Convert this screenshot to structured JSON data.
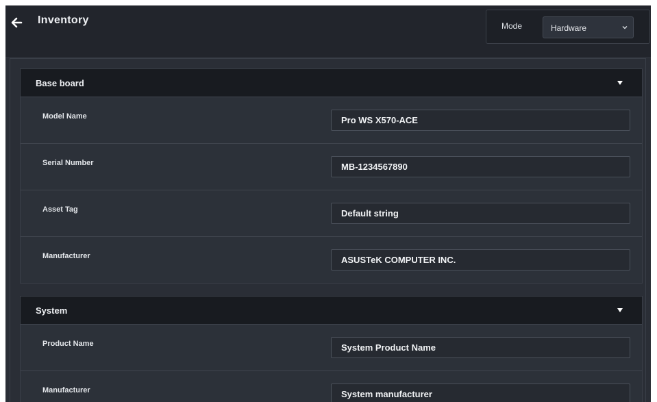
{
  "header": {
    "title": "Inventory",
    "back_icon": "arrow-left-icon",
    "mode_label": "Mode",
    "mode_value": "Hardware"
  },
  "sections": [
    {
      "title": "Base board",
      "rows": [
        {
          "label": "Model Name",
          "value": "Pro WS X570-ACE"
        },
        {
          "label": "Serial Number",
          "value": "MB-1234567890"
        },
        {
          "label": "Asset Tag",
          "value": "Default string"
        },
        {
          "label": "Manufacturer",
          "value": "ASUSTeK COMPUTER INC."
        }
      ]
    },
    {
      "title": "System",
      "rows": [
        {
          "label": "Product Name",
          "value": "System Product Name"
        },
        {
          "label": "Manufacturer",
          "value": "System manufacturer"
        }
      ]
    }
  ],
  "colors": {
    "background": "#2a2e36",
    "header": "#22252c",
    "section_header": "#181b20",
    "text": "#eef0f3"
  }
}
